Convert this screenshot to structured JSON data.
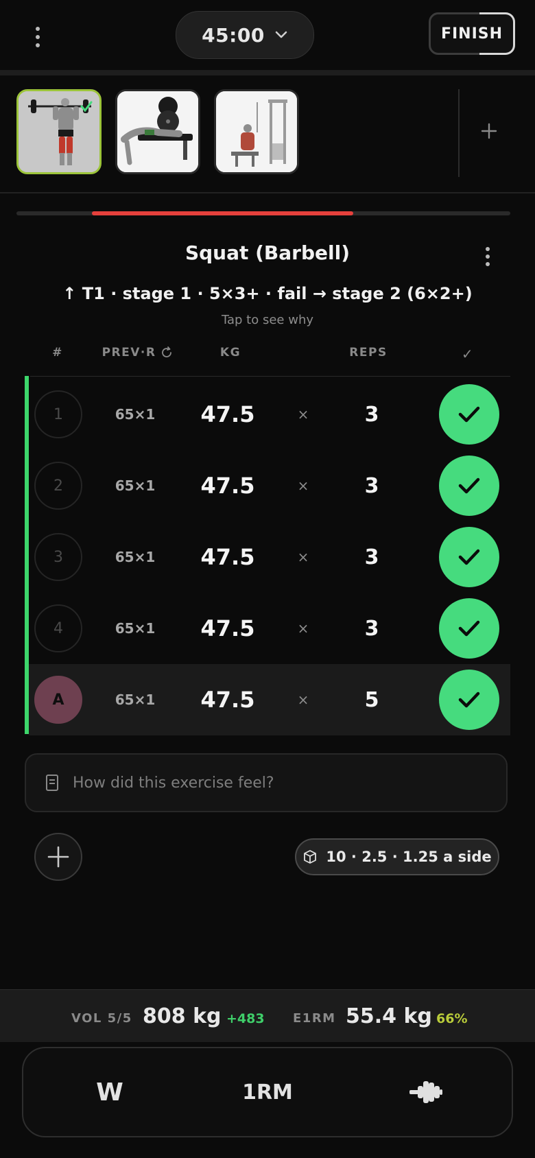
{
  "header": {
    "timer": "45:00",
    "finish_label": "FINISH"
  },
  "thumbnails": [
    {
      "name": "barbell-squat-thumb",
      "active": true,
      "done": true
    },
    {
      "name": "bench-press-thumb",
      "active": false,
      "done": false
    },
    {
      "name": "seated-cable-row-thumb",
      "active": false,
      "done": false
    }
  ],
  "progress": 0.66,
  "exercise": {
    "title": "Squat (Barbell)",
    "stage": "↑ T1 · stage 1 · 5×3+ · fail → stage 2 (6×2+)",
    "hint": "Tap to see why"
  },
  "table": {
    "headers": {
      "num": "#",
      "prev": "PREV·R",
      "kg": "KG",
      "reps": "REPS",
      "check": "✓"
    },
    "rows": [
      {
        "set": "1",
        "prev": "65×1",
        "kg": "47.5",
        "x": "×",
        "reps": "3",
        "done": true
      },
      {
        "set": "2",
        "prev": "65×1",
        "kg": "47.5",
        "x": "×",
        "reps": "3",
        "done": true
      },
      {
        "set": "3",
        "prev": "65×1",
        "kg": "47.5",
        "x": "×",
        "reps": "3",
        "done": true
      },
      {
        "set": "4",
        "prev": "65×1",
        "kg": "47.5",
        "x": "×",
        "reps": "3",
        "done": true
      },
      {
        "set": "A",
        "prev": "65×1",
        "kg": "47.5",
        "x": "×",
        "reps": "5",
        "done": true
      }
    ]
  },
  "notes": {
    "placeholder": "How did this exercise feel?"
  },
  "plates": {
    "label": "10 · 2.5 · 1.25 a side"
  },
  "stats": {
    "vol_label": "VOL 5/5",
    "vol_value": "808 kg",
    "vol_delta": "+483",
    "e1rm_label": "E1RM",
    "e1rm_value": "55.4 kg",
    "e1rm_pct": "66%"
  },
  "toolbar": {
    "warmup_label": "W",
    "onerm_label": "1RM"
  },
  "colors": {
    "accent_green": "#46db7e",
    "progress_red": "#e5403c",
    "delta_green": "#3fcf6a",
    "pct_yellow": "#b9cc3a",
    "amrap_badge": "#6e4050"
  }
}
